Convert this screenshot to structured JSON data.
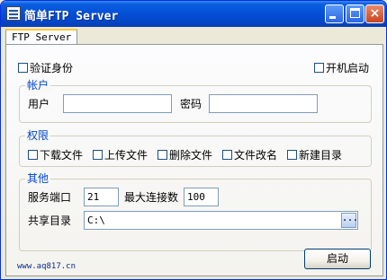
{
  "window": {
    "title": "简单FTP Server",
    "icon": "app-icon",
    "controls": {
      "minimize": "minimize-icon",
      "maximize": "maximize-icon",
      "close": "×"
    }
  },
  "tabs": [
    {
      "label": "FTP Server",
      "active": true
    }
  ],
  "options": {
    "verify_identity": {
      "label": "验证身份",
      "checked": false
    },
    "autostart": {
      "label": "开机启动",
      "checked": false
    }
  },
  "account": {
    "group_title": "帐户",
    "user_label": "用户",
    "user_value": "",
    "password_label": "密码",
    "password_value": ""
  },
  "permissions": {
    "group_title": "权限",
    "items": [
      {
        "label": "下载文件",
        "checked": false
      },
      {
        "label": "上传文件",
        "checked": false
      },
      {
        "label": "删除文件",
        "checked": false
      },
      {
        "label": "文件改名",
        "checked": false
      },
      {
        "label": "新建目录",
        "checked": false
      }
    ]
  },
  "other": {
    "group_title": "其他",
    "port_label": "服务端口",
    "port_value": "21",
    "max_conn_label": "最大连接数",
    "max_conn_value": "100",
    "share_dir_label": "共享目录",
    "share_dir_value": "C:\\",
    "browse_label": "..."
  },
  "footer": {
    "link": "www.aq817.cn",
    "start_button": "启动"
  },
  "colors": {
    "titlebar": "#0550d8",
    "group_title": "#0046d5",
    "tab_highlight": "#ffc83c"
  }
}
